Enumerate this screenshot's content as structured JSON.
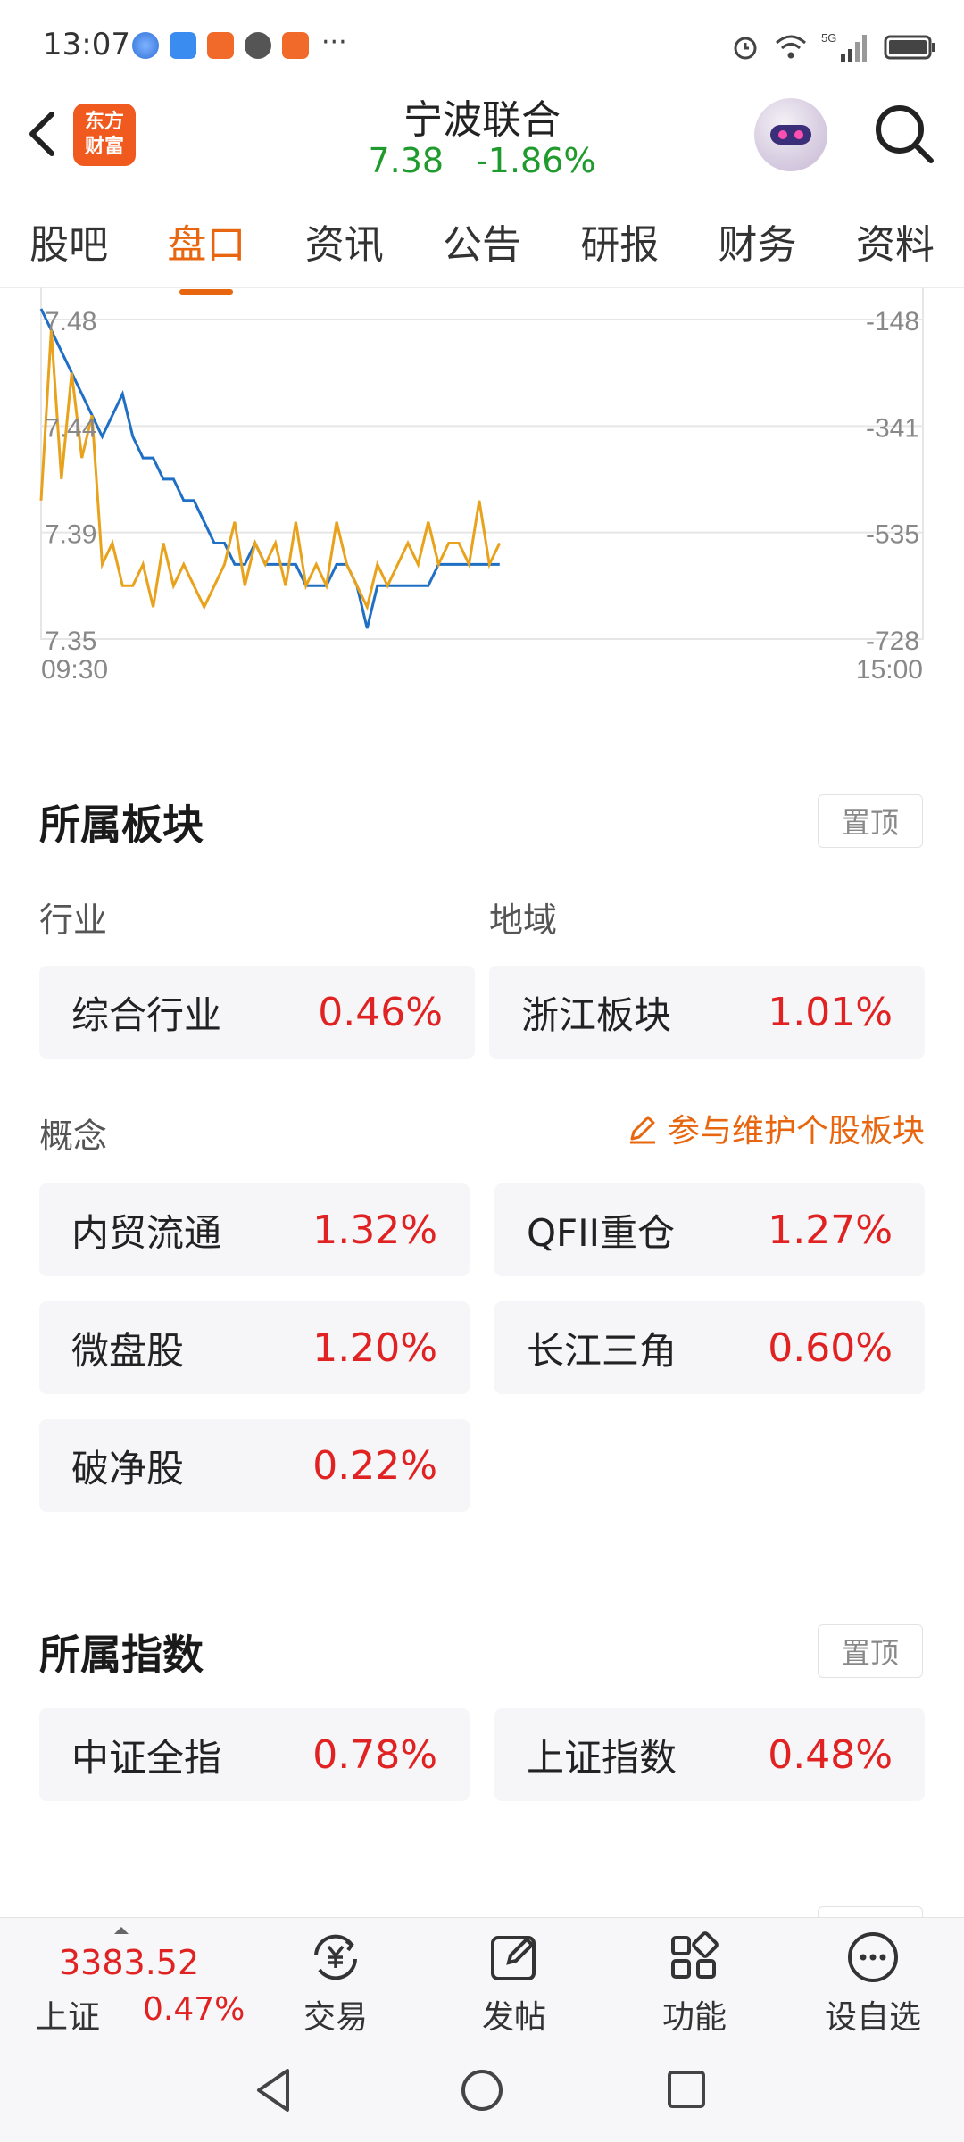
{
  "status_bar": {
    "time": "13:07",
    "more_indicator": "···",
    "icons": [
      "browser-icon",
      "app-notify-icon",
      "redpacket-icon",
      "chat-icon",
      "redpacket-icon",
      "alarm-icon",
      "wifi-icon",
      "signal-5g-icon",
      "battery-icon"
    ]
  },
  "header": {
    "back_icon": "chevron-left-icon",
    "logo_line1": "东方",
    "logo_line2": "财富",
    "stock_name": "宁波联合",
    "price": "7.38",
    "change_pct": "-1.86%",
    "search_icon": "search-icon",
    "colors": {
      "down": "#1f9a2c",
      "accent": "#e8660f"
    }
  },
  "tabs": [
    {
      "label": "股吧",
      "active": false
    },
    {
      "label": "盘口",
      "active": true
    },
    {
      "label": "资讯",
      "active": false
    },
    {
      "label": "公告",
      "active": false
    },
    {
      "label": "研报",
      "active": false
    },
    {
      "label": "财务",
      "active": false
    },
    {
      "label": "资料",
      "active": false
    }
  ],
  "chart_data": {
    "type": "line",
    "x_start": "09:30",
    "x_end": "15:00",
    "y_labels_left": [
      "7.48",
      "7.44",
      "7.39",
      "7.35"
    ],
    "y_labels_right": [
      "-148",
      "-341",
      "-535",
      "-728"
    ],
    "series": [
      {
        "color": "#1f6fc4",
        "values": [
          7.49,
          7.48,
          7.47,
          7.46,
          7.45,
          7.44,
          7.43,
          7.44,
          7.45,
          7.43,
          7.42,
          7.42,
          7.41,
          7.41,
          7.4,
          7.4,
          7.39,
          7.38,
          7.38,
          7.37,
          7.37,
          7.38,
          7.37,
          7.37,
          7.37,
          7.37,
          7.36,
          7.36,
          7.36,
          7.37,
          7.37,
          7.36,
          7.34,
          7.36,
          7.36,
          7.36,
          7.36,
          7.36,
          7.36,
          7.37,
          7.37,
          7.37,
          7.37,
          7.37,
          7.37,
          7.37
        ]
      },
      {
        "color": "#e8a21c",
        "values": [
          7.4,
          7.48,
          7.41,
          7.46,
          7.42,
          7.44,
          7.37,
          7.38,
          7.36,
          7.36,
          7.37,
          7.35,
          7.38,
          7.36,
          7.37,
          7.36,
          7.35,
          7.36,
          7.37,
          7.39,
          7.36,
          7.38,
          7.37,
          7.38,
          7.36,
          7.39,
          7.36,
          7.37,
          7.36,
          7.39,
          7.37,
          7.36,
          7.35,
          7.37,
          7.36,
          7.37,
          7.38,
          7.37,
          7.39,
          7.37,
          7.38,
          7.38,
          7.37,
          7.4,
          7.37,
          7.38
        ]
      }
    ],
    "grid": true
  },
  "sectors": {
    "title": "所属板块",
    "pin_label": "置顶",
    "industry_label": "行业",
    "region_label": "地域",
    "concept_label": "概念",
    "maintain_label": "参与维护个股板块",
    "industry": {
      "name": "综合行业",
      "pct": "0.46%"
    },
    "region": {
      "name": "浙江板块",
      "pct": "1.01%"
    },
    "concepts": [
      {
        "name": "内贸流通",
        "pct": "1.32%"
      },
      {
        "name": "QFII重仓",
        "pct": "1.27%"
      },
      {
        "name": "微盘股",
        "pct": "1.20%"
      },
      {
        "name": "长江三角",
        "pct": "0.60%"
      },
      {
        "name": "破净股",
        "pct": "0.22%"
      }
    ]
  },
  "indices": {
    "title": "所属指数",
    "pin_label": "置顶",
    "items": [
      {
        "name": "中证全指",
        "pct": "0.78%"
      },
      {
        "name": "上证指数",
        "pct": "0.48%"
      }
    ]
  },
  "bottom_bar": {
    "index_value": "3383.52",
    "index_name": "上证",
    "index_pct": "0.47%",
    "items": [
      {
        "label": "交易",
        "icon": "trade-yen-icon"
      },
      {
        "label": "发帖",
        "icon": "post-edit-icon"
      },
      {
        "label": "功能",
        "icon": "functions-grid-icon"
      },
      {
        "label": "设自选",
        "icon": "more-dots-icon"
      }
    ]
  },
  "nav_bar": {
    "icons": [
      "nav-back-icon",
      "nav-home-icon",
      "nav-recents-icon"
    ]
  }
}
